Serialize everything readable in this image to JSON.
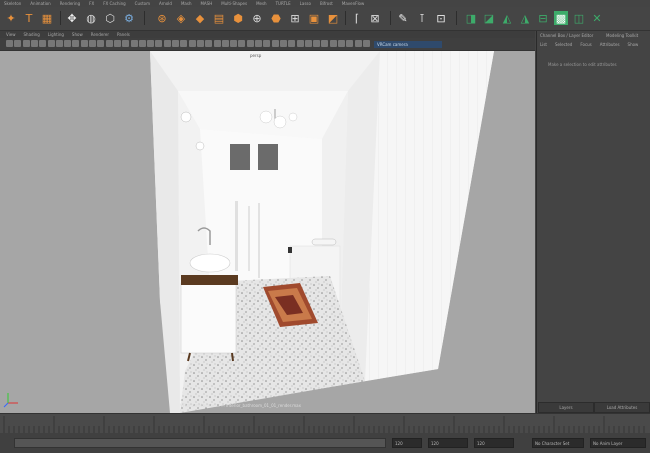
{
  "menubar": [
    "Skeleton",
    "Animation",
    "Rendering",
    "FX",
    "FX Caching",
    "Custom",
    "Arnold",
    "Mash",
    "MASH",
    "Multi-Shapes",
    "Mesh",
    "TURTLE",
    "Lasso",
    "Bifrost",
    "MavenFlow"
  ],
  "viewport_menu": [
    "View",
    "Shading",
    "Lighting",
    "Show",
    "Renderer",
    "Panels"
  ],
  "viewport_camera": "VRCam camera",
  "viewport_label": "persp",
  "viewport_caption": "VFB/frameNumber : ... interior_bathroom_01_01_render.max",
  "right_panel": {
    "title": "Channel Box / Layer Editor",
    "title_alt": "Modeling Toolkit",
    "tabs": [
      "List",
      "Selected",
      "Focus",
      "Attributes",
      "Show"
    ],
    "message": "Make a selection to edit attributes",
    "bottom_buttons": [
      "Layers",
      "Load Attributes"
    ]
  },
  "range": {
    "start": "120",
    "current": "120",
    "end": "120",
    "no_character_set": "No Character Set",
    "no_anim_layer": "No Anim Layer"
  },
  "icons": {
    "shelf": [
      "move-tool-icon",
      "text-tool-icon",
      "grid-icon",
      "transform-icon",
      "sphere-icon",
      "mesh-icon",
      "render-icon",
      "lasso-icon",
      "bevel-icon",
      "extrude-icon",
      "bridge-icon",
      "script-icon",
      "measure-icon",
      "constraint-icon",
      "uv-icon",
      "display-icon",
      "layer-icon",
      "wrap-icon"
    ]
  },
  "colors": {
    "accent": "#e8913c",
    "selection": "#2f4a6c",
    "green_tools": "#3dab6a"
  }
}
